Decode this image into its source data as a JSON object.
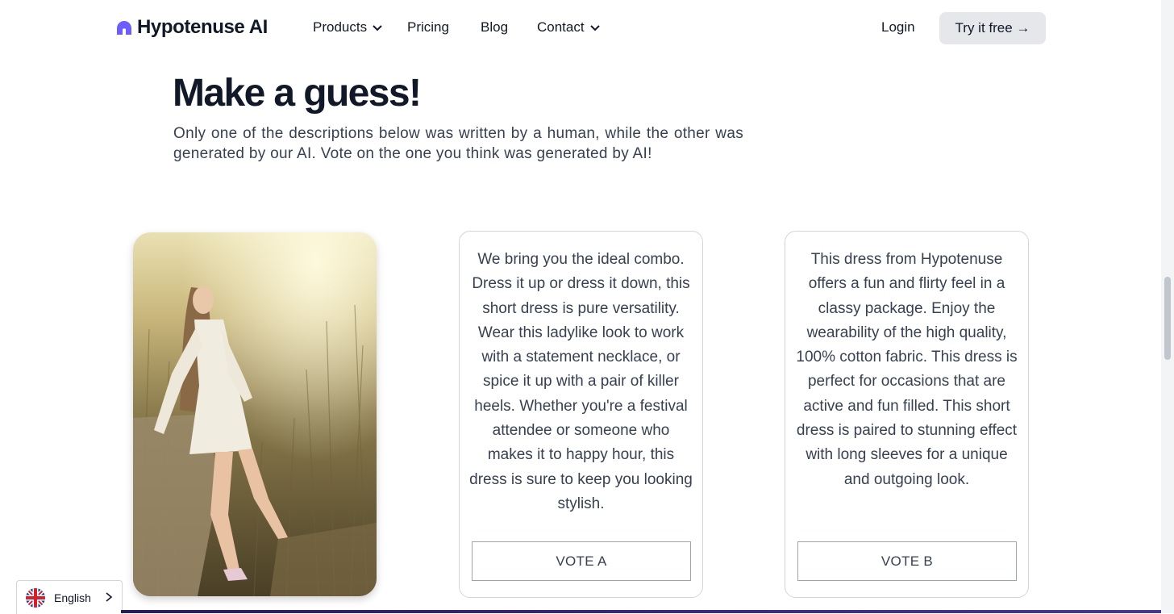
{
  "nav": {
    "brand": "Hypotenuse AI",
    "links": [
      "Products",
      "Pricing",
      "Blog",
      "Contact"
    ],
    "login": "Login",
    "cta": "Try it free →"
  },
  "hero": {
    "title": "Make a guess!",
    "subtitle": "Only one of the descriptions below was written by a human, while the other was generated by our AI. Vote on the one you think was generated by AI!"
  },
  "cards": [
    {
      "text": "We bring you the ideal combo. Dress it up or dress it down, this short dress is pure versatility. Wear this ladylike look to work with a statement necklace, or spice it up with a pair of killer heels. Whether you're a festival attendee or someone who makes it to happy hour, this dress is sure to keep you looking stylish.",
      "vote": "VOTE A"
    },
    {
      "text": "This dress from Hypotenuse offers a fun and flirty feel in a classy package. Enjoy the wearability of the high quality, 100% cotton fabric. This dress is perfect for occasions that are active and fun filled. This short dress is paired to stunning effect with long sleeves for a unique and outgoing look.",
      "vote": "VOTE B"
    }
  ],
  "language": {
    "label": "English",
    "icon": "uk-flag-icon"
  },
  "colors": {
    "brand": "#6d5dfc",
    "heading": "#111827",
    "cta_bg": "#e5e7eb"
  }
}
